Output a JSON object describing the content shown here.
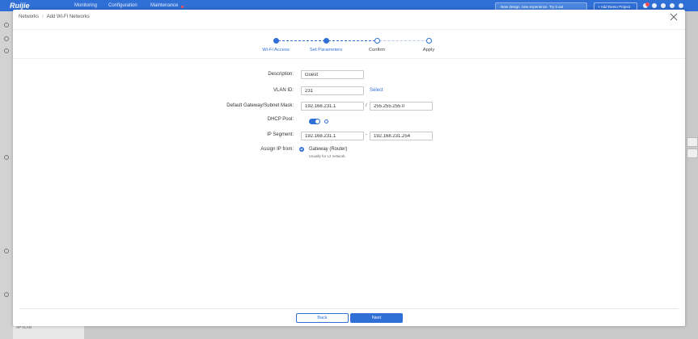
{
  "app": {
    "logo": "Ruijie",
    "nav": [
      "Monitoring",
      "Configuration",
      "Maintenance"
    ],
    "promo": "New design, new experience. Try it out",
    "add_project": "+ Add Demo Project",
    "notification_count": "4",
    "bottom_label": "AP VLAN",
    "brand_color": "#2f6fd6"
  },
  "modal": {
    "breadcrumb": [
      "Networks",
      "Add Wi-Fi Networks"
    ],
    "steps": [
      {
        "label": "Wi-Fi Access",
        "state": "done"
      },
      {
        "label": "Set Parameters",
        "state": "done"
      },
      {
        "label": "Confirm",
        "state": "todo"
      },
      {
        "label": "Apply",
        "state": "todo"
      }
    ],
    "form": {
      "description_label": "Description:",
      "description_value": "Guest",
      "vlan_label": "VLAN ID:",
      "vlan_value": "231",
      "vlan_select": "Select",
      "gateway_label": "Default Gateway/Subnet Mask:",
      "gateway_value": "192.168.231.1",
      "gateway_sep": "/",
      "mask_value": "255.255.255.0",
      "dhcp_label": "DHCP Pool:",
      "dhcp_enabled": true,
      "segment_label": "IP Segment:",
      "segment_start": "192.168.231.1",
      "segment_sep": "-",
      "segment_end": "192.168.231.254",
      "assign_label": "Assign IP from:",
      "assign_option": "Gateway (Router)",
      "assign_hint": "Usually for L2 network."
    },
    "buttons": {
      "back": "Back",
      "next": "Next"
    }
  }
}
